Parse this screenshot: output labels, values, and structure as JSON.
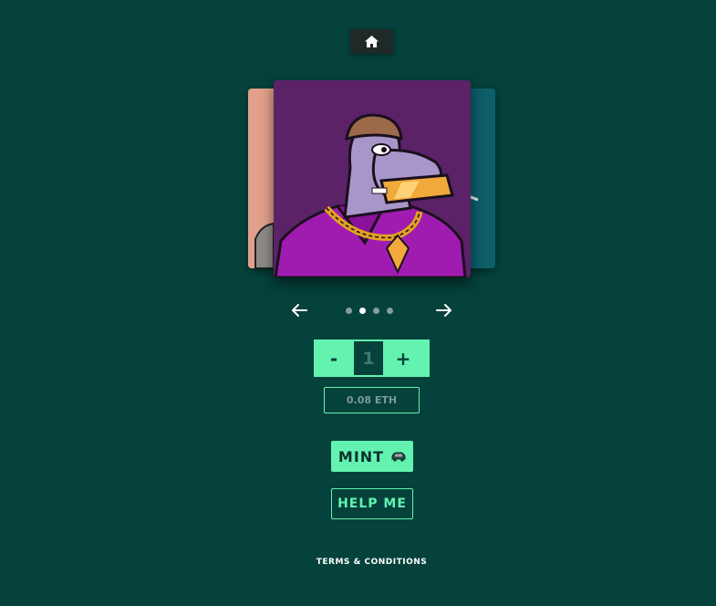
{
  "nav": {
    "home_icon": "home-icon"
  },
  "carousel": {
    "cards": [
      {
        "name": "peach-card",
        "color": "#e2a08a"
      },
      {
        "name": "purple-card",
        "color": "#5b2268"
      },
      {
        "name": "teal-card",
        "color": "#0d5f6a"
      }
    ],
    "active_index": 1,
    "page_count": 4,
    "prev_icon": "arrow-left-icon",
    "next_icon": "arrow-right-icon"
  },
  "quantity": {
    "minus_label": "-",
    "value": "1",
    "plus_label": "+"
  },
  "price": {
    "label": "0.08 ETH"
  },
  "mint": {
    "label": "MINT",
    "icon": "car-icon"
  },
  "help": {
    "label": "HELP ME"
  },
  "footer": {
    "terms_label": "TERMS & CONDITIONS"
  },
  "colors": {
    "background": "#04423b",
    "accent": "#64f2b0",
    "card_main": "#5b2268"
  }
}
